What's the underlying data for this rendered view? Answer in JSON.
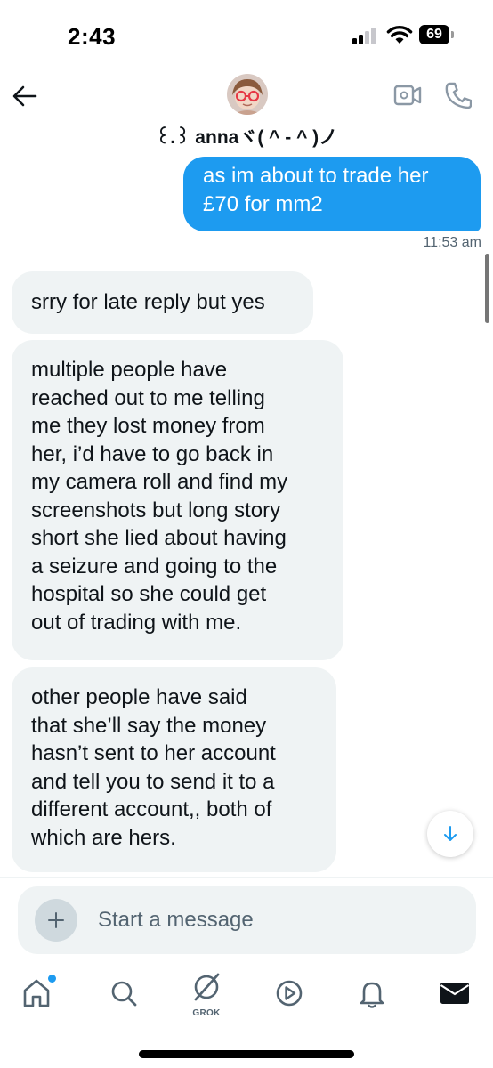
{
  "status_bar": {
    "time": "2:43",
    "battery": "69"
  },
  "header": {
    "contact_name": "꒰.꒱ annaヾ( ^ - ^ )ノ",
    "back_icon": "arrow-left-icon",
    "video_icon": "video-camera-icon",
    "phone_icon": "phone-icon"
  },
  "messages": [
    {
      "direction": "sent",
      "lines": [
        "as im about to trade her",
        "£70 for mm2"
      ]
    },
    {
      "direction": "meta",
      "time": "11:53 am"
    },
    {
      "direction": "received",
      "lines": [
        "srry for late reply but yes"
      ]
    },
    {
      "direction": "received",
      "lines": [
        "multiple people have",
        "reached out to me telling",
        "me they lost money from",
        "her, i’d have to go back in",
        "my camera roll and find my",
        "screenshots but long story",
        "short she lied about having",
        "a seizure and going to the",
        "hospital so she could get",
        "out of trading with me."
      ]
    },
    {
      "direction": "received",
      "lines": [
        "other people have said",
        "that she’ll say the money",
        "hasn’t sent to her account",
        "and tell you to send it to a",
        "different account,, both of",
        "which are hers."
      ]
    }
  ],
  "composer": {
    "placeholder": "Start a message",
    "add_icon": "plus-icon",
    "voice_icon": "voice-waveform-icon"
  },
  "bottom_nav": {
    "items": [
      "home-icon",
      "search-icon",
      "grok-icon",
      "play-circle-icon",
      "bell-icon",
      "mail-icon"
    ],
    "grok_label": "GROK"
  },
  "colors": {
    "accent": "#1d9bf0",
    "received_bubble": "#eff3f4",
    "secondary_text": "#536471",
    "voice_gradient_start": "#7856ff",
    "voice_gradient_end": "#1d9bf0"
  }
}
